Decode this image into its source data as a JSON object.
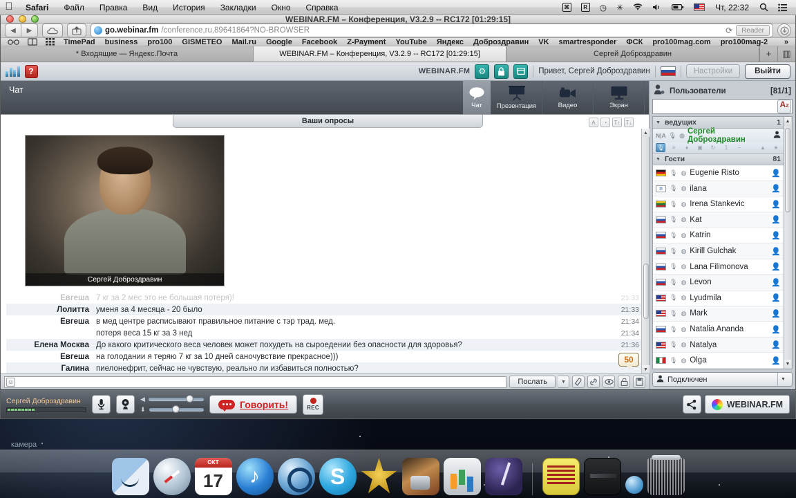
{
  "menubar": {
    "apple": "apple-logo",
    "items": [
      {
        "label": "Safari",
        "bold": true
      },
      {
        "label": "Файл",
        "bold": false
      },
      {
        "label": "Правка",
        "bold": false
      },
      {
        "label": "Вид",
        "bold": false
      },
      {
        "label": "История",
        "bold": false
      },
      {
        "label": "Закладки",
        "bold": false
      },
      {
        "label": "Окно",
        "bold": false
      },
      {
        "label": "Справка",
        "bold": false
      }
    ],
    "status_icons": [
      "keyboard-viewer-icon",
      "rescuetime-icon",
      "timemachine-icon",
      "bluetooth-icon",
      "wifi-icon",
      "volume-icon",
      "battery-icon",
      "us-flag-icon"
    ],
    "glyphs": {
      "timemachine": "◷",
      "bluetooth": "✳",
      "wifi": "◕",
      "volume": "◀",
      "battery": "▭",
      "keyboard": "⌘",
      "rescuetime": "R",
      "search": "⌕",
      "notifications": "☰"
    },
    "clock": "Чт, 22:32"
  },
  "window": {
    "title": "WEBINAR.FM – Конференция, V3.2.9 -- RC172 [01:29:15]",
    "toolbar": {
      "back": "◀",
      "forward": "▶",
      "icloud": "☁",
      "share": "↗",
      "url_domain": "go.webinar.fm",
      "url_path": "/conference,ru,89641864?NO-BROWSER",
      "reload": "⟳",
      "reader_label": "Reader",
      "downloads": "⬤"
    },
    "bookmarks": {
      "icons": [
        "reading-glasses-icon",
        "book-icon",
        "grid-icon"
      ],
      "glyphs": {
        "glasses": "6∂",
        "book": "▭",
        "grid": "▦"
      },
      "items": [
        "TimePad",
        "business",
        "pro100",
        "GISMETEO",
        "Mail.ru",
        "Google",
        "Facebook",
        "Z-Payment",
        "YouTube",
        "Яндекс",
        "Доброздравин",
        "VK",
        "smartresponder",
        "ФСК",
        "pro100mag.com",
        "pro100mag-2"
      ],
      "more": "»"
    },
    "tabs": [
      {
        "label": "* Входящие — Яндекс.Почта",
        "active": false
      },
      {
        "label": "WEBINAR.FM – Конференция, V3.2.9 -- RC172 [01:29:15]",
        "active": true
      },
      {
        "label": "Сергей Доброздравин",
        "active": false
      }
    ],
    "tab_add": "+",
    "tab_overview": "▥"
  },
  "app": {
    "header": {
      "logo": "bars-logo-icon",
      "help_label": "?",
      "brand": "WEBINAR.FM",
      "gear": "⚙",
      "lock": "🔒",
      "lock_glyph": "▥",
      "archive_glyph": "▤",
      "greeting": "Привет, Сергей Доброздравин",
      "language": "ru-flag-icon",
      "settings_label": "Настройки",
      "logout_label": "Выйти"
    },
    "chat_panel": {
      "title": "Чат",
      "modes": [
        {
          "label": "Чат",
          "icon": "speech-bubble-icon",
          "active": true
        },
        {
          "label": "Презентация",
          "icon": "projector-screen-icon",
          "active": false
        },
        {
          "label": "Видео",
          "icon": "video-camera-icon",
          "active": false
        },
        {
          "label": "Экран",
          "icon": "monitor-icon",
          "active": false
        }
      ]
    },
    "stage": {
      "polls_label": "Ваши опросы",
      "tools": [
        "font-color-icon",
        "timer-icon",
        "font-increase-icon",
        "font-decrease-icon"
      ],
      "tool_glyphs": [
        "A",
        "◔",
        "T↑",
        "T↓"
      ],
      "video_caption": "Сергей Доброздравин"
    },
    "messages": [
      {
        "name": "Евгеша",
        "text": "7 кг за 2 мес это не большая потеря)!",
        "time": "21:33",
        "faded": true
      },
      {
        "name": "Лолитта",
        "text": "уменя за 4 месяца - 20 было",
        "time": "21:33",
        "faded": false
      },
      {
        "name": "Евгеша",
        "text": "в мед центре расписывают правильное питание с тэр трад. мед.",
        "time": "21:34",
        "faded": false
      },
      {
        "name": "",
        "text": "потеря веса 15 кг за 3 нед",
        "time": "21:34",
        "faded": false
      },
      {
        "name": "Елена Москва",
        "text": "До какого критического веса человек может похудеть на сыроедении без опасности для здоровья?",
        "time": "21:36",
        "faded": false
      },
      {
        "name": "Евгеша",
        "text": "на голодании я теряю 7 кг за 10 дней саночувствие прекрасное)))",
        "time": "",
        "faded": false
      },
      {
        "name": "Галина",
        "text": "пиелонефрит,  сейчас не чувствую, реально ли избавиться полностью?",
        "time": "",
        "faded": false
      }
    ],
    "unread_badge": "50",
    "composer": {
      "smiley": "☺",
      "input_value": "",
      "input_placeholder": "",
      "send_label": "Послать",
      "caret": "▼",
      "tools": [
        "eraser-icon",
        "link-icon",
        "eye-icon",
        "unlock-icon",
        "save-icon"
      ],
      "tool_glyphs": [
        "◗",
        "🔗",
        "◉",
        "⌂",
        "▤"
      ]
    },
    "users": {
      "icon": "users-icon",
      "title": "Пользователи",
      "count": "[81/1]",
      "search_value": "",
      "search_placeholder": "",
      "sort_label": "A",
      "sort_sup": "Z",
      "groups": [
        {
          "label": "ведущих",
          "count": "1"
        },
        {
          "label": "Гости",
          "count": "81"
        }
      ],
      "host": {
        "na": "N|A",
        "name": "Сергей Доброздравин",
        "person_icon": "person-icon"
      },
      "host_tools": [
        "mic-on-icon",
        "list-icon",
        "mic-icon",
        "cam-icon",
        "refresh-icon",
        "one-icon",
        "minus-icon",
        "up-icon",
        "star-icon"
      ],
      "host_tool_glyphs": [
        "🎙",
        "≡",
        "♦",
        "▣",
        "↻",
        "1",
        "−",
        "▲",
        "★"
      ],
      "guests": [
        {
          "name": "Eugenie Risto",
          "flag": "f-de"
        },
        {
          "name": "ilana",
          "flag": "f-il"
        },
        {
          "name": "Irena Stankevic",
          "flag": "f-lt"
        },
        {
          "name": "Kat",
          "flag": "f-ru"
        },
        {
          "name": "Katrin",
          "flag": "f-ru"
        },
        {
          "name": "Kirill Gulchak",
          "flag": "f-ru"
        },
        {
          "name": "Lana Filimonova",
          "flag": "f-ru"
        },
        {
          "name": "Levon",
          "flag": "f-ru"
        },
        {
          "name": "Lyudmila",
          "flag": "f-us"
        },
        {
          "name": "Mark",
          "flag": "f-us"
        },
        {
          "name": "Natalia Ananda",
          "flag": "f-ru"
        },
        {
          "name": "Natalya",
          "flag": "f-us"
        },
        {
          "name": "Olga",
          "flag": "f-it"
        }
      ],
      "status": {
        "icon": "person-icon",
        "label": "Подключен",
        "caret": "▼"
      }
    },
    "footer": {
      "me_name": "Сергей Доброздравин",
      "mic_icon": "microphone-icon",
      "cam_icon": "webcam-icon",
      "speaker_glyph": "◀",
      "mic_glyph": "⬇",
      "speak_label": "Говорить!",
      "rec_label": "REC",
      "share_icon": "share-nodes-icon",
      "brand": "WEBINAR.FM",
      "camera_hint": "камера"
    }
  },
  "dock": {
    "items": [
      {
        "name": "finder",
        "cls": "d-finder",
        "round": false
      },
      {
        "name": "safari",
        "cls": "d-safari2",
        "round": true
      },
      {
        "name": "calendar",
        "cls": "d-cal",
        "round": false,
        "month": "ОКТ",
        "day": "17"
      },
      {
        "name": "itunes",
        "cls": "d-itunes",
        "round": true
      },
      {
        "name": "quicktime",
        "cls": "d-qt",
        "round": true
      },
      {
        "name": "skype",
        "cls": "d-skype",
        "round": true
      },
      {
        "name": "imovie",
        "cls": "d-imovie",
        "round": false
      },
      {
        "name": "iphoto",
        "cls": "d-iphoto",
        "round": false
      },
      {
        "name": "keynote",
        "cls": "d-key",
        "round": false
      },
      {
        "name": "illustrator",
        "cls": "d-ai",
        "round": false
      },
      {
        "name": "poster",
        "cls": "d-poster",
        "round": false
      },
      {
        "name": "media-device",
        "cls": "d-black",
        "round": false
      },
      {
        "name": "trash",
        "cls": "d-trash",
        "round": false
      }
    ]
  }
}
